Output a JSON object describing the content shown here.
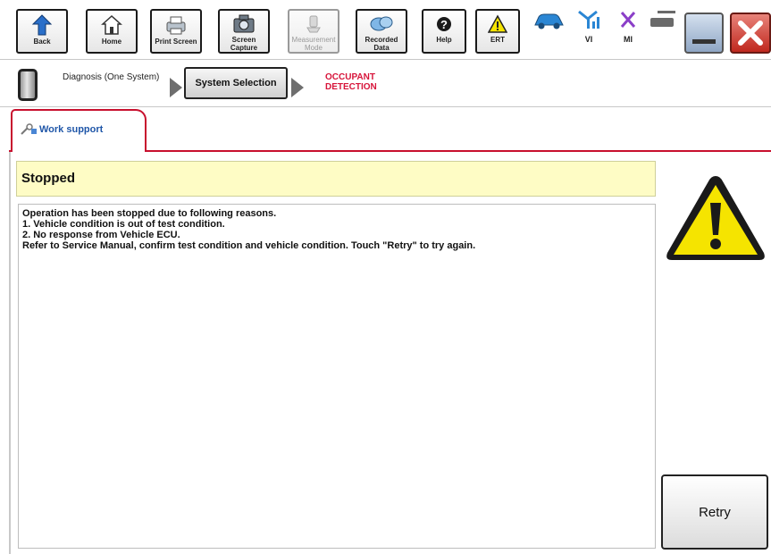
{
  "toolbar": {
    "back": "Back",
    "home": "Home",
    "print_screen": "Print Screen",
    "screen_capture": "Screen Capture",
    "measurement_mode": "Measurement Mode",
    "recorded_data": "Recorded Data",
    "help": "Help",
    "ert": "ERT",
    "vi": "VI",
    "mi": "MI"
  },
  "breadcrumb": {
    "step1": "Diagnosis (One System)",
    "step2": "System Selection",
    "step3": "OCCUPANT DETECTION"
  },
  "tab": {
    "label": "Work support"
  },
  "status": {
    "title": "Stopped"
  },
  "message": {
    "lines": [
      "Operation has been stopped due to following reasons.",
      "1. Vehicle condition is out of test condition.",
      "2. No response from Vehicle ECU.",
      "Refer to Service Manual, confirm test condition and vehicle condition. Touch \"Retry\" to try again."
    ]
  },
  "actions": {
    "retry": "Retry"
  },
  "colors": {
    "accent_red": "#c8102e",
    "status_yellow": "#fefcc5",
    "tab_text_blue": "#1f56a8",
    "warning_yellow": "#f5e400"
  }
}
